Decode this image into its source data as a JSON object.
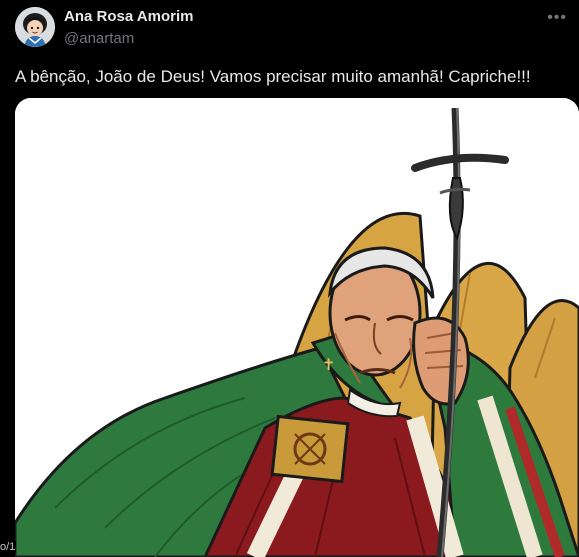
{
  "tweet": {
    "author_name": "Ana Rosa Amorim",
    "author_handle": "@anartam",
    "more_icon": "ellipsis-icon",
    "text": "A bênção, João de Deus! Vamos precisar muito amanhã! Capriche!!!"
  },
  "edge_text": "o/1"
}
